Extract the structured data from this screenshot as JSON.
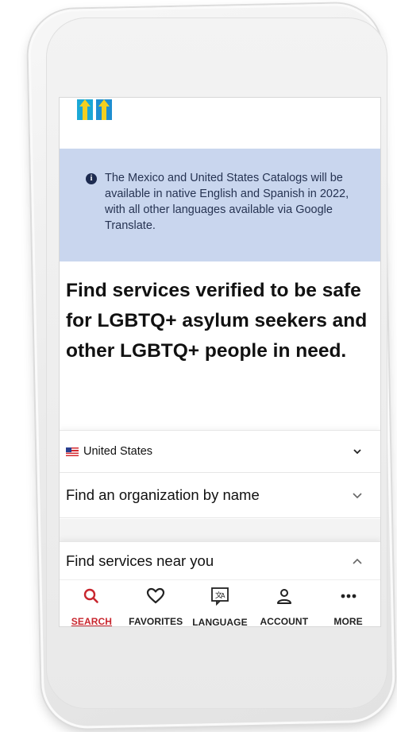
{
  "info_banner": {
    "text": "The Mexico and United States Catalogs will be available in native English and Spanish in 2022, with all other languages available via Google Translate."
  },
  "headline": "Find services verified to be safe for LGBTQ+ asylum seekers and other LGBTQ+ people in need.",
  "country_select": {
    "value": "United States"
  },
  "org_search": {
    "label": "Find an organization by name"
  },
  "services_near": {
    "label": "Find services near you"
  },
  "tabs": [
    {
      "label": "SEARCH",
      "icon": "search-icon",
      "active": true
    },
    {
      "label": "FAVORITES",
      "icon": "heart-icon",
      "active": false
    },
    {
      "label": "LANGUAGE",
      "icon": "translate-icon",
      "active": false
    },
    {
      "label": "ACCOUNT",
      "icon": "person-icon",
      "active": false
    },
    {
      "label": "MORE",
      "icon": "more-icon",
      "active": false
    }
  ],
  "colors": {
    "banner_bg": "#c9d6ee",
    "active_tab": "#c8262e",
    "logo_blue": "#1ba8d6",
    "logo_yellow": "#f4cf1f"
  }
}
